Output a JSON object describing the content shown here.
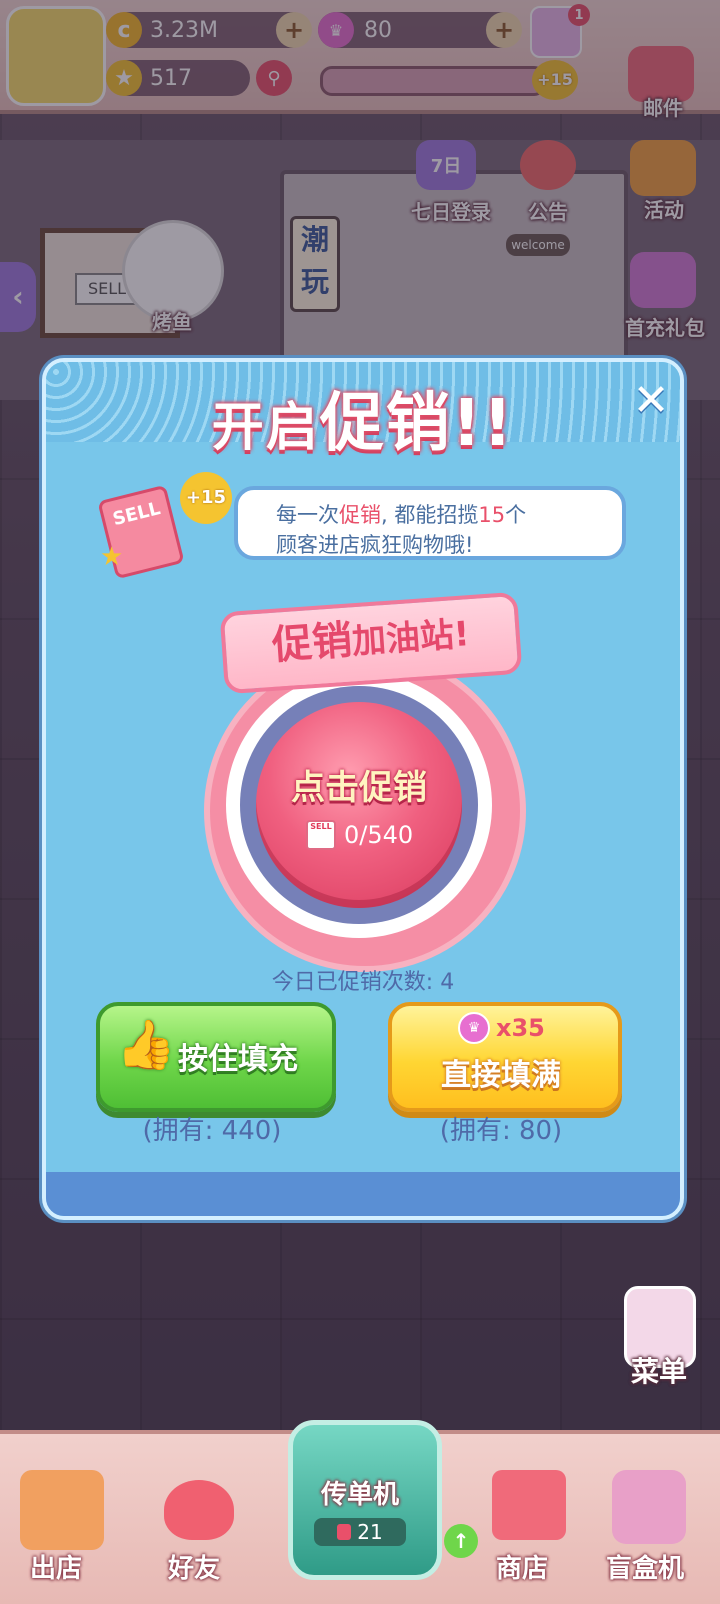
{
  "hud": {
    "coins": "3.23M",
    "gems": "80",
    "stars": "517",
    "notif_badge": "1",
    "plus_badge": "+15"
  },
  "side_icons": {
    "mail": "邮件",
    "seven_day": "七日登录",
    "seven_day_badge": "7日",
    "notice": "公告",
    "activity": "活动",
    "first_charge": "首充礼包",
    "grill_fish": "烤鱼",
    "menu": "菜单"
  },
  "scene": {
    "sign": "潮玩",
    "welcome": "welcome",
    "sell_board": "SELL"
  },
  "dialog": {
    "title_a": "开启",
    "title_b": "促销",
    "title_c": "!!",
    "tip_prefix": "每一次",
    "tip_hl1": "促销",
    "tip_mid": ", 都能招揽",
    "tip_hl2": "15",
    "tip_suffix": "个",
    "tip_line2": "顾客进店疯狂购物哦!",
    "card_badge": "+15",
    "card_text": "SELL",
    "station_a": "促销",
    "station_b": "加油站!",
    "big_button": "点击促销",
    "big_button_count": "0/540",
    "mini_sell": "SELL",
    "today": "今日已促销次数: 4",
    "fill_label": "按住填充",
    "full_label": "直接填满",
    "full_cost": "x35",
    "own_fill": "(拥有: 440)",
    "own_full": "(拥有: 80)",
    "close": "✕"
  },
  "bottom_nav": {
    "out_shop": "出店",
    "friends": "好友",
    "flyer": "传单机",
    "flyer_count": "21",
    "shop": "商店",
    "blind_box": "盲盒机"
  },
  "colors": {
    "dialog_bg": "#78c6ea",
    "accent_pink": "#e9506a",
    "green_btn": "#6fd64a",
    "yellow_btn": "#ffd633"
  }
}
